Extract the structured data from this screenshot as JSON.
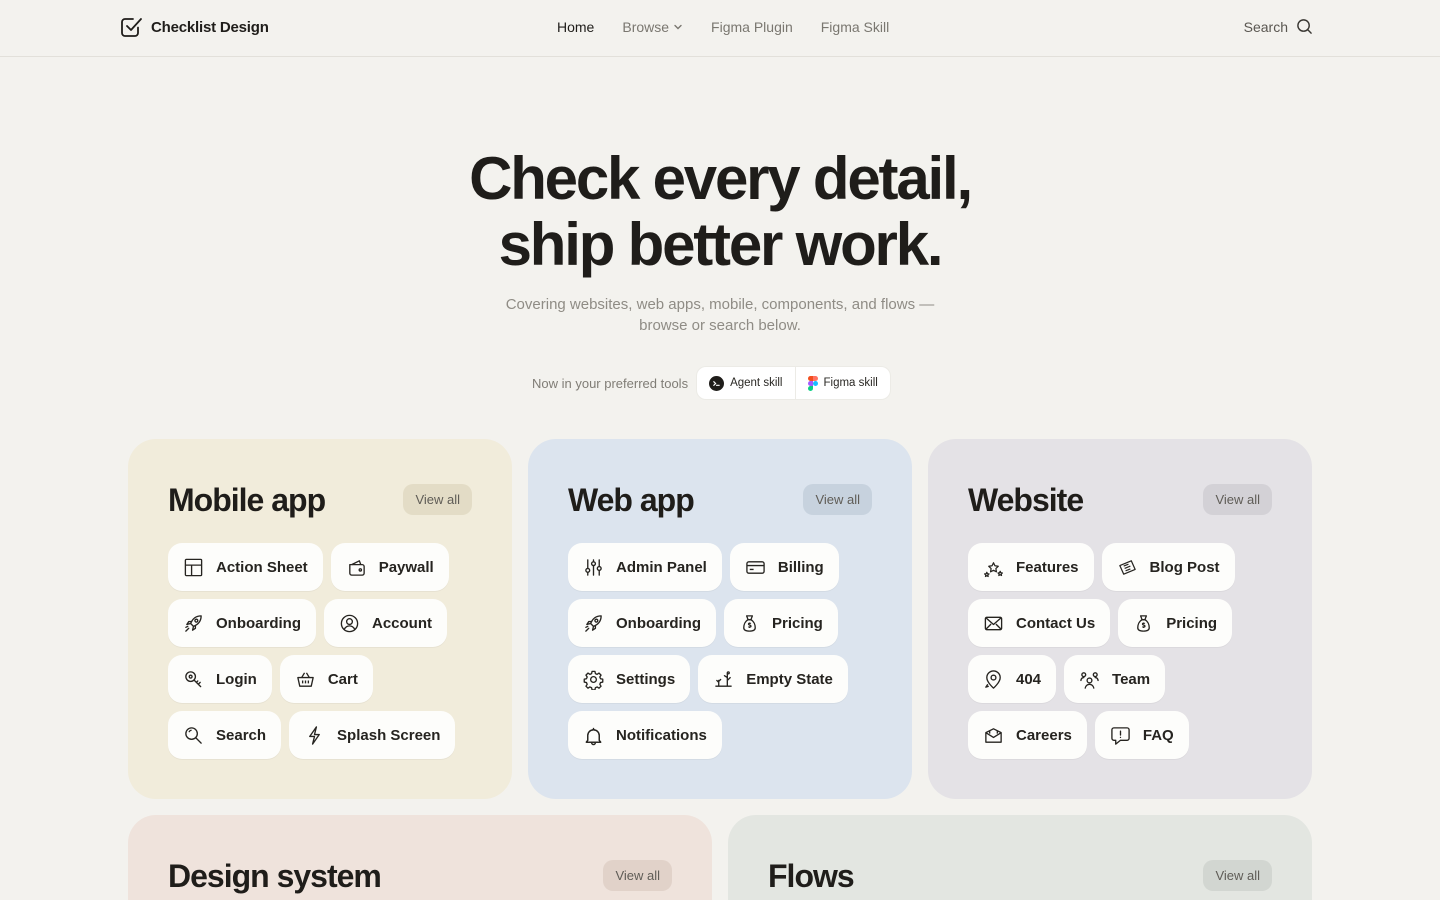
{
  "nav": {
    "brand": "Checklist Design",
    "links": [
      {
        "label": "Home",
        "active": true
      },
      {
        "label": "Browse",
        "dropdown": true
      },
      {
        "label": "Figma Plugin"
      },
      {
        "label": "Figma Skill"
      }
    ],
    "search_label": "Search"
  },
  "hero": {
    "title_line1": "Check every detail,",
    "title_line2": "ship better work.",
    "subtitle": "Covering websites, web apps, mobile, components, and flows — browse or search below."
  },
  "tools": {
    "label": "Now in your preferred tools",
    "items": [
      "Agent skill",
      "Figma skill"
    ]
  },
  "categories": {
    "view_all": "View all",
    "mobile": {
      "title": "Mobile app",
      "items": [
        {
          "label": "Action Sheet",
          "icon": "layout-icon"
        },
        {
          "label": "Paywall",
          "icon": "wallet-icon"
        },
        {
          "label": "Onboarding",
          "icon": "rocket-icon"
        },
        {
          "label": "Account",
          "icon": "user-circle-icon"
        },
        {
          "label": "Login",
          "icon": "key-icon"
        },
        {
          "label": "Cart",
          "icon": "basket-icon"
        },
        {
          "label": "Search",
          "icon": "search-icon"
        },
        {
          "label": "Splash Screen",
          "icon": "bolt-icon"
        }
      ]
    },
    "web": {
      "title": "Web app",
      "items": [
        {
          "label": "Admin Panel",
          "icon": "sliders-icon"
        },
        {
          "label": "Billing",
          "icon": "credit-card-icon"
        },
        {
          "label": "Onboarding",
          "icon": "rocket-icon"
        },
        {
          "label": "Pricing",
          "icon": "money-bag-icon"
        },
        {
          "label": "Settings",
          "icon": "gear-icon"
        },
        {
          "label": "Empty State",
          "icon": "tumbleweed-icon"
        },
        {
          "label": "Notifications",
          "icon": "bell-icon"
        }
      ]
    },
    "website": {
      "title": "Website",
      "items": [
        {
          "label": "Features",
          "icon": "stars-icon"
        },
        {
          "label": "Blog Post",
          "icon": "newspaper-icon"
        },
        {
          "label": "Contact Us",
          "icon": "envelope-icon"
        },
        {
          "label": "Pricing",
          "icon": "money-bag-icon"
        },
        {
          "label": "404",
          "icon": "map-pin-icon"
        },
        {
          "label": "Team",
          "icon": "team-icon"
        },
        {
          "label": "Careers",
          "icon": "inbox-icon"
        },
        {
          "label": "FAQ",
          "icon": "chat-question-icon"
        }
      ]
    },
    "design_system": {
      "title": "Design system"
    },
    "flows": {
      "title": "Flows"
    }
  },
  "colors": {
    "background": "#f3f2ee",
    "mobile_card": "#f1ecdb",
    "web_card": "#dce4ee",
    "website_card": "#e4e2e6",
    "design_system_card": "#efe3dc",
    "flows_card": "#e3e6e1",
    "text": "#1f1d1a"
  }
}
